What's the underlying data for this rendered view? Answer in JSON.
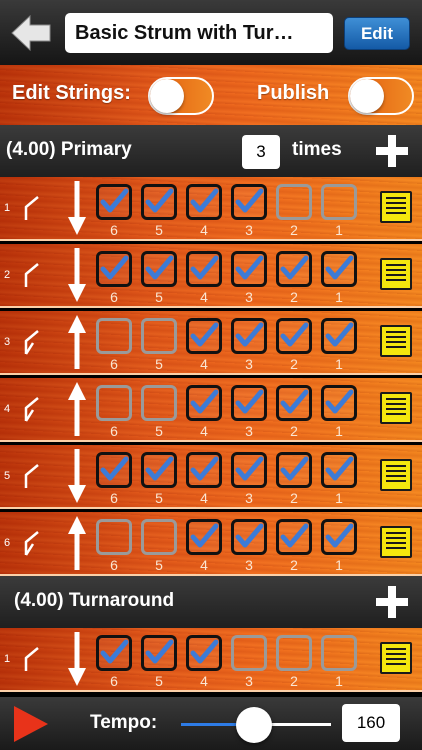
{
  "header": {
    "title": "Basic Strum with Tur…",
    "edit_label": "Edit"
  },
  "options": {
    "edit_strings_label": "Edit Strings:",
    "edit_strings_on": false,
    "publish_label": "Publish",
    "publish_on": false
  },
  "sections": [
    {
      "title": "(4.00) Primary",
      "repeat_count": "3",
      "times_label": "times",
      "rows": [
        {
          "num": "1",
          "stroke": "down",
          "checks": [
            true,
            true,
            true,
            true,
            false,
            false
          ]
        },
        {
          "num": "2",
          "stroke": "down",
          "checks": [
            true,
            true,
            true,
            true,
            true,
            true
          ]
        },
        {
          "num": "3",
          "stroke": "up",
          "checks": [
            false,
            false,
            true,
            true,
            true,
            true
          ]
        },
        {
          "num": "4",
          "stroke": "up",
          "checks": [
            false,
            false,
            true,
            true,
            true,
            true
          ]
        },
        {
          "num": "5",
          "stroke": "down",
          "checks": [
            true,
            true,
            true,
            true,
            true,
            true
          ]
        },
        {
          "num": "6",
          "stroke": "up",
          "checks": [
            false,
            false,
            true,
            true,
            true,
            true
          ]
        }
      ]
    },
    {
      "title": "(4.00) Turnaround",
      "rows": [
        {
          "num": "1",
          "stroke": "down",
          "checks": [
            true,
            true,
            true,
            false,
            false,
            false
          ]
        }
      ]
    }
  ],
  "string_numbers": [
    "6",
    "5",
    "4",
    "3",
    "2",
    "1"
  ],
  "footer": {
    "tempo_label": "Tempo:",
    "tempo_value": "160"
  },
  "colors": {
    "edit_button": "#1e6fbf",
    "play_icon": "#e8331a",
    "check_mark": "#3d7bd6",
    "note_icon": "#f4e70e"
  }
}
